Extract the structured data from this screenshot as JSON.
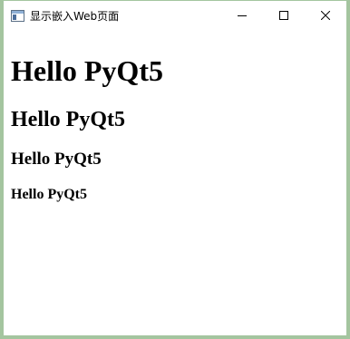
{
  "window": {
    "title": "显示嵌入Web页面"
  },
  "content": {
    "h1": "Hello PyQt5",
    "h2": "Hello PyQt5",
    "h3": "Hello PyQt5",
    "h4": "Hello PyQt5"
  },
  "icons": {
    "app": "app-window-icon",
    "minimize": "minimize-icon",
    "maximize": "maximize-icon",
    "close": "close-icon"
  },
  "colors": {
    "frame": "#a4c59f",
    "background": "#ffffff",
    "text": "#000000"
  }
}
